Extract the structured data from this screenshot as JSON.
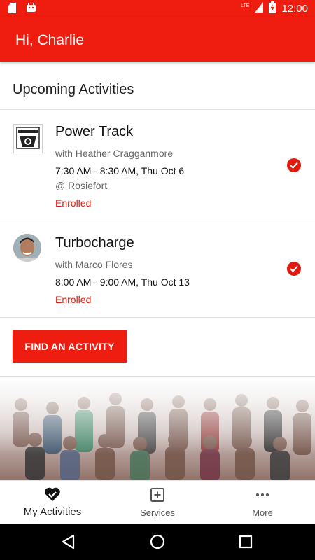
{
  "status_bar": {
    "time": "12:00",
    "network": "LTE"
  },
  "header": {
    "title": "Hi, Charlie"
  },
  "section": {
    "title": "Upcoming Activities"
  },
  "activities": [
    {
      "title": "Power Track",
      "instructor": "with Heather Cragganmore",
      "time": "7:30 AM - 8:30 AM, Thu Oct 6",
      "location": "@ Rosiefort",
      "status": "Enrolled",
      "thumb_icon": "club-logo-icon"
    },
    {
      "title": "Turbocharge",
      "instructor": "with Marco Flores",
      "time": "8:00 AM - 9:00 AM, Thu Oct 13",
      "status": "Enrolled",
      "thumb_icon": "avatar"
    }
  ],
  "find_button": {
    "label": "FIND AN ACTIVITY"
  },
  "tabs": [
    {
      "label": "My Activities",
      "icon": "heart-check-icon",
      "active": true
    },
    {
      "label": "Services",
      "icon": "plus-square-icon",
      "active": false
    },
    {
      "label": "More",
      "icon": "more-dots-icon",
      "active": false
    }
  ],
  "colors": {
    "brand": "#ee1d0f",
    "status_text": "#e01b0e"
  }
}
